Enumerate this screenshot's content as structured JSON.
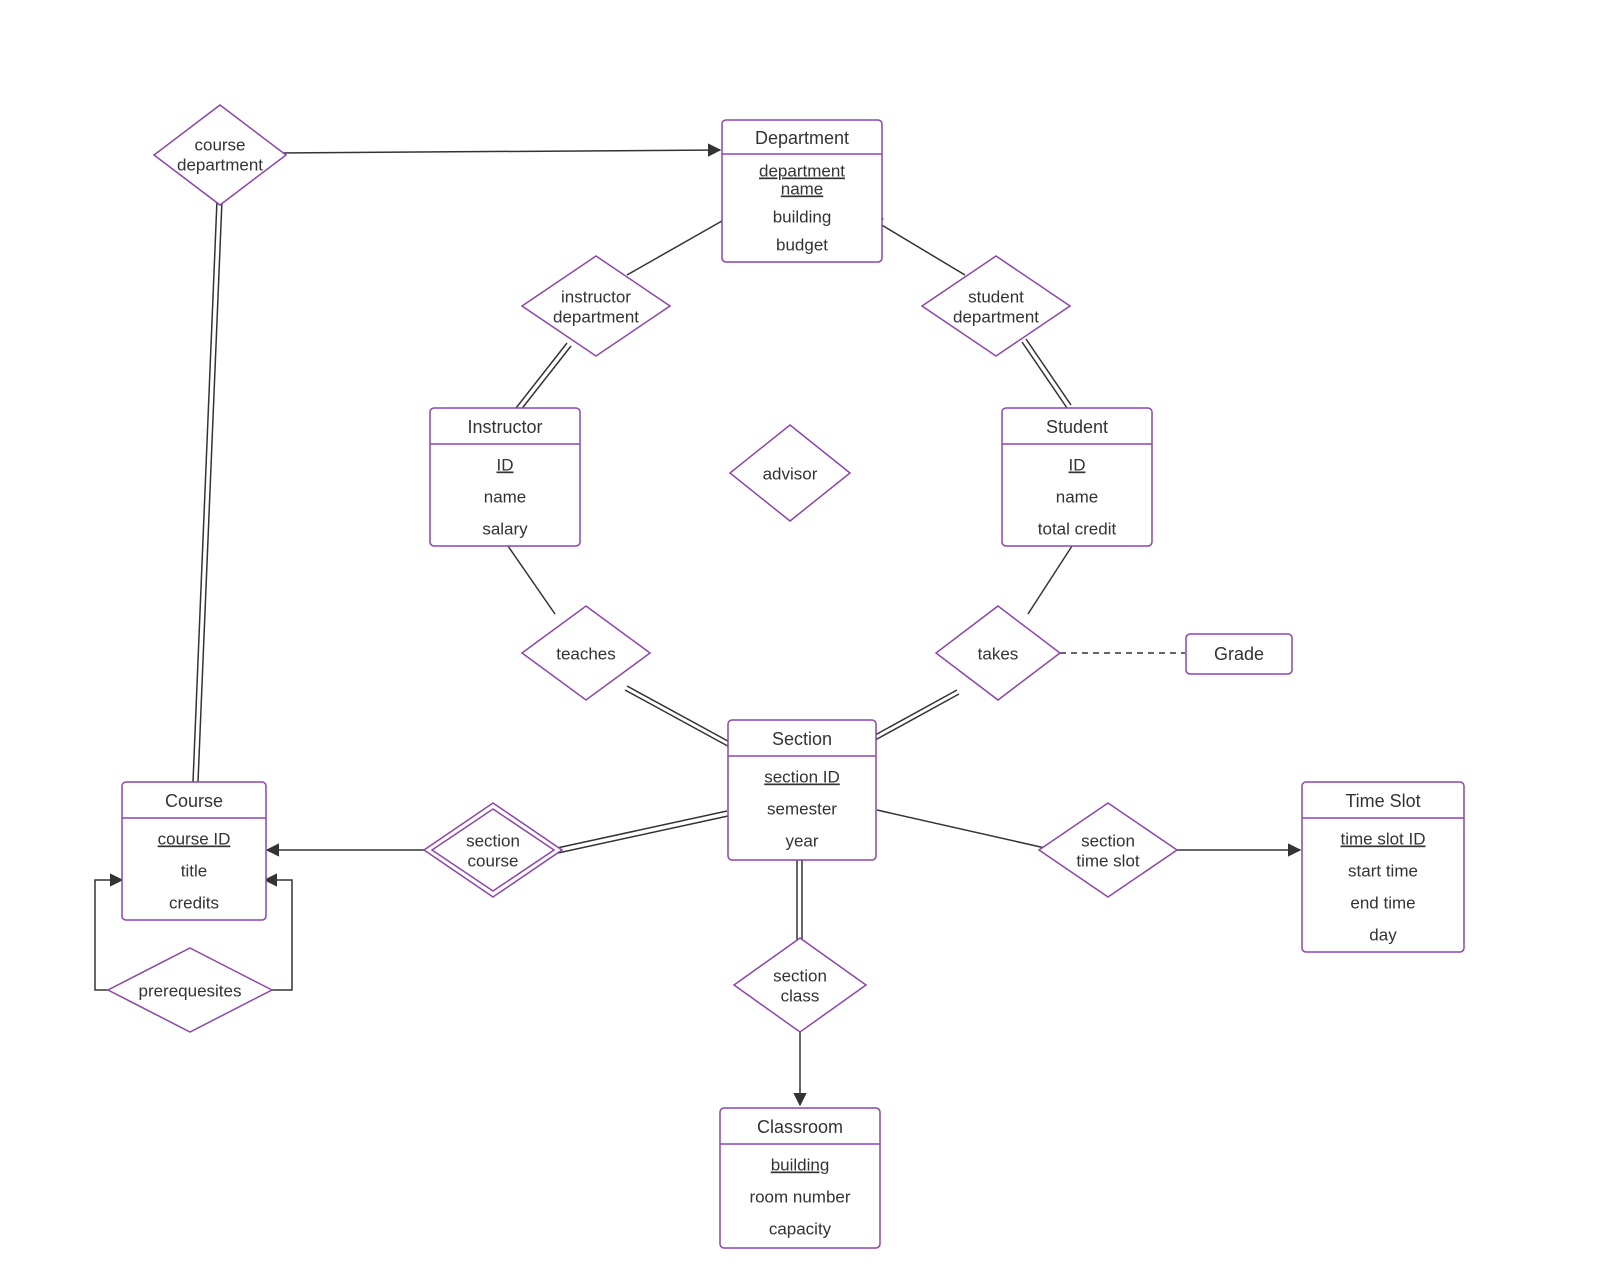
{
  "entities": {
    "department": {
      "title": "Department",
      "attrs": [
        "department name",
        "building",
        "budget"
      ],
      "key_idx": 0,
      "multiline_key": true
    },
    "instructor": {
      "title": "Instructor",
      "attrs": [
        "ID",
        "name",
        "salary"
      ],
      "key_idx": 0
    },
    "student": {
      "title": "Student",
      "attrs": [
        "ID",
        "name",
        "total credit"
      ],
      "key_idx": 0
    },
    "section": {
      "title": "Section",
      "attrs": [
        "section ID",
        "semester",
        "year"
      ],
      "key_idx": 0
    },
    "course": {
      "title": "Course",
      "attrs": [
        "course ID",
        "title",
        "credits"
      ],
      "key_idx": 0
    },
    "timeslot": {
      "title": "Time Slot",
      "attrs": [
        "time slot ID",
        "start time",
        "end time",
        "day"
      ],
      "key_idx": 0
    },
    "classroom": {
      "title": "Classroom",
      "attrs": [
        "building",
        "room number",
        "capacity"
      ],
      "key_idx": 0
    },
    "grade": {
      "title": "Grade"
    }
  },
  "relationships": {
    "course_department": [
      "course",
      "department"
    ],
    "instructor_department": [
      "instructor",
      "department"
    ],
    "student_department": [
      "student",
      "department"
    ],
    "advisor": "advisor",
    "teaches": "teaches",
    "takes": "takes",
    "section_course": [
      "section",
      "course"
    ],
    "section_timeslot": [
      "section",
      "time slot"
    ],
    "section_class": [
      "section",
      "class"
    ],
    "prerequisites": "prerequesites"
  }
}
